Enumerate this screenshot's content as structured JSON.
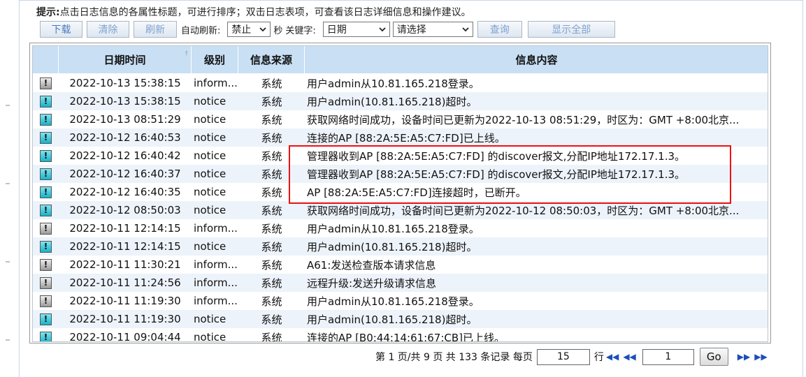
{
  "hint": {
    "label": "提示:",
    "text": "点击日志信息的各属性标题，可进行排序；双击日志表项，可查看该日志详细信息和操作建议。"
  },
  "toolbar": {
    "download": "下载",
    "clear": "清除",
    "refresh": "刷新",
    "auto_refresh_label": "自动刷新:",
    "auto_refresh_value": "禁止",
    "seconds_label": "秒",
    "keyword_label": "关键字:",
    "keyword_field": "日期",
    "keyword_value": "请选择",
    "search": "查询",
    "show_all": "显示全部"
  },
  "table": {
    "columns": [
      "日期时间",
      "级别",
      "信息来源",
      "信息内容"
    ],
    "rows": [
      {
        "datetime": "2022-10-13 15:38:15",
        "level": "inform...",
        "source": "系统",
        "message": "用户admin从10.81.165.218登录。",
        "type": "info"
      },
      {
        "datetime": "2022-10-13 15:38:15",
        "level": "notice",
        "source": "系统",
        "message": "用户admin(10.81.165.218)超时。",
        "type": "notice"
      },
      {
        "datetime": "2022-10-13 08:51:29",
        "level": "notice",
        "source": "系统",
        "message": "获取网络时间成功，设备时间已更新为2022-10-13 08:51:29，时区为：GMT +8:00北京...",
        "type": "notice"
      },
      {
        "datetime": "2022-10-12 16:40:53",
        "level": "notice",
        "source": "系统",
        "message": "连接的AP [88:2A:5E:A5:C7:FD]已上线。",
        "type": "notice"
      },
      {
        "datetime": "2022-10-12 16:40:42",
        "level": "notice",
        "source": "系统",
        "message": "管理器收到AP [88:2A:5E:A5:C7:FD] 的discover报文,分配IP地址172.17.1.3。",
        "type": "notice"
      },
      {
        "datetime": "2022-10-12 16:40:37",
        "level": "notice",
        "source": "系统",
        "message": "管理器收到AP [88:2A:5E:A5:C7:FD] 的discover报文,分配IP地址172.17.1.3。",
        "type": "notice"
      },
      {
        "datetime": "2022-10-12 16:40:35",
        "level": "notice",
        "source": "系统",
        "message": "AP [88:2A:5E:A5:C7:FD]连接超时，已断开。",
        "type": "notice"
      },
      {
        "datetime": "2022-10-12 08:50:03",
        "level": "notice",
        "source": "系统",
        "message": "获取网络时间成功，设备时间已更新为2022-10-12 08:50:03，时区为：GMT +8:00北京...",
        "type": "notice"
      },
      {
        "datetime": "2022-10-11 12:14:15",
        "level": "inform...",
        "source": "系统",
        "message": "用户admin从10.81.165.218登录。",
        "type": "info"
      },
      {
        "datetime": "2022-10-11 12:14:15",
        "level": "notice",
        "source": "系统",
        "message": "用户admin(10.81.165.218)超时。",
        "type": "notice"
      },
      {
        "datetime": "2022-10-11 11:30:21",
        "level": "inform...",
        "source": "系统",
        "message": "A61:发送检查版本请求信息",
        "type": "info"
      },
      {
        "datetime": "2022-10-11 11:24:56",
        "level": "inform...",
        "source": "系统",
        "message": "远程升级:发送升级请求信息",
        "type": "info"
      },
      {
        "datetime": "2022-10-11 11:19:30",
        "level": "inform...",
        "source": "系统",
        "message": "用户admin从10.81.165.218登录。",
        "type": "info"
      },
      {
        "datetime": "2022-10-11 11:19:30",
        "level": "notice",
        "source": "系统",
        "message": "用户admin(10.81.165.218)超时。",
        "type": "notice"
      },
      {
        "datetime": "2022-10-11 09:04:44",
        "level": "notice",
        "source": "系统",
        "message": "连接的AP [B0:44:14:61:67:CB]已上线。",
        "type": "notice"
      }
    ]
  },
  "pager": {
    "summary": "第 1 页/共 9 页 共 133 条记录 每页",
    "per_page": "15",
    "rows_label": "行",
    "page_input": "1",
    "go": "Go"
  },
  "colors": {
    "header_bg": "#c8dff4",
    "alt_row_bg": "#edf3fa",
    "highlight": "#e11111",
    "link_blue": "#4a7cc0"
  }
}
